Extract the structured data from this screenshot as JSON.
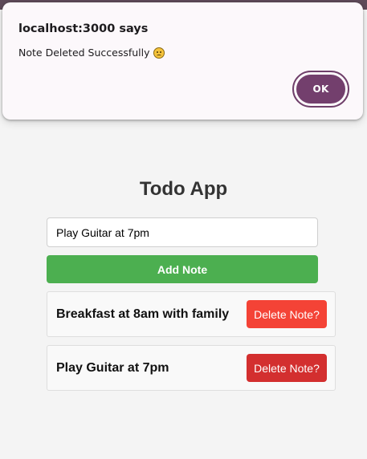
{
  "dialog": {
    "title": "localhost:3000 says",
    "message": "Note Deleted Successfully",
    "emoji": "frowning-face-icon",
    "ok_label": "OK"
  },
  "app": {
    "title": "Todo App",
    "input_value": "Play Guitar at 7pm",
    "add_label": "Add Note",
    "notes": [
      {
        "text": "Breakfast at 8am with family",
        "delete_label": "Delete Note?"
      },
      {
        "text": "Play Guitar at 7pm",
        "delete_label": "Delete Note?"
      }
    ]
  },
  "colors": {
    "ok_button": "#733f6d",
    "add_button": "#4caf50",
    "delete_button": "#f44336",
    "delete_button_hover": "#d32f2f"
  }
}
